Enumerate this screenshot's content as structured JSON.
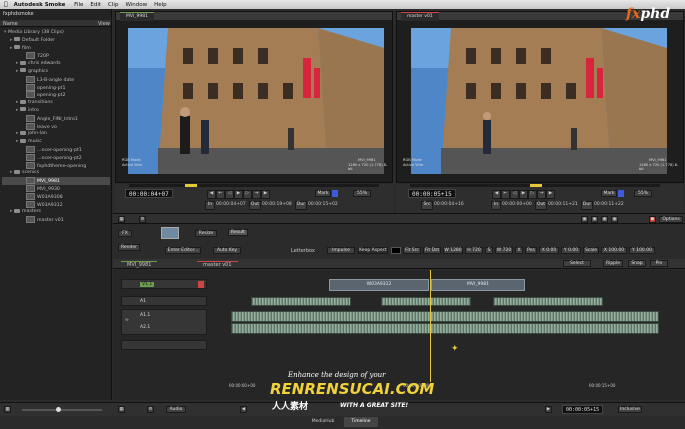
{
  "menubar": {
    "apple": "",
    "app_name": "Autodesk Smoke",
    "items": [
      "File",
      "Edit",
      "Clip",
      "Window",
      "Help"
    ]
  },
  "library": {
    "project": "fxphdsmoke",
    "name_col": "Name",
    "view_col": "View",
    "title": "Media Library (38 Clips)",
    "rows": [
      {
        "indent": 1,
        "kind": "folder",
        "label": "Default Folder"
      },
      {
        "indent": 1,
        "kind": "folder",
        "label": "film"
      },
      {
        "indent": 3,
        "kind": "clip",
        "label": "720P"
      },
      {
        "indent": 2,
        "kind": "folder",
        "label": "chris edwards"
      },
      {
        "indent": 2,
        "kind": "folder",
        "label": "graphics"
      },
      {
        "indent": 3,
        "kind": "clip",
        "label": "L3-B-angle date"
      },
      {
        "indent": 3,
        "kind": "clip",
        "label": "opening-pt1"
      },
      {
        "indent": 3,
        "kind": "clip",
        "label": "opening-pt2"
      },
      {
        "indent": 2,
        "kind": "folder",
        "label": "transitions"
      },
      {
        "indent": 2,
        "kind": "folder",
        "label": "intro"
      },
      {
        "indent": 3,
        "kind": "clip",
        "label": "Angle_FINI_Intro1"
      },
      {
        "indent": 3,
        "kind": "clip",
        "label": "leave vo"
      },
      {
        "indent": 2,
        "kind": "folder",
        "label": "john-lan"
      },
      {
        "indent": 2,
        "kind": "folder",
        "label": "music"
      },
      {
        "indent": 3,
        "kind": "clip",
        "label": "...ncer-opening-pt1"
      },
      {
        "indent": 3,
        "kind": "clip",
        "label": "...ncer-opening-pt2"
      },
      {
        "indent": 3,
        "kind": "clip",
        "label": "fxphdtheme-opening"
      },
      {
        "indent": 1,
        "kind": "folder",
        "label": "scenics"
      },
      {
        "indent": 3,
        "kind": "clip",
        "label": "MVI_9981",
        "selected": true
      },
      {
        "indent": 3,
        "kind": "clip",
        "label": "MVI_9930"
      },
      {
        "indent": 3,
        "kind": "clip",
        "label": "W03A9308"
      },
      {
        "indent": 3,
        "kind": "clip",
        "label": "W03A9312"
      },
      {
        "indent": 1,
        "kind": "folder",
        "label": "masters"
      },
      {
        "indent": 3,
        "kind": "clip",
        "label": "master v01"
      }
    ]
  },
  "source_viewer": {
    "tab": "MVI_9981",
    "ovl_tl": "RGB Mode",
    "ovl_bl": "Active    Wire",
    "ovl_tr": "MVI_9981",
    "ovl_br": "1280 x 720 (1.778) 8-bit",
    "timecode": "00:00:04+07",
    "in_label": "In",
    "in_tc": "00:00:04+07",
    "out_label": "Out",
    "out_tc": "00:00:19+08",
    "dur_label": "Dur",
    "dur_tc": "00:00:15+02",
    "mark": "Mark",
    "zoom": "55%"
  },
  "record_viewer": {
    "tab": "master v01",
    "ovl_tl": "RGB Mode",
    "ovl_bl": "Active    Wire",
    "ovl_tr": "MVI_9981",
    "ovl_br": "1280 x 720 (1.778) 8-bit",
    "timecode": "00:00:05+15",
    "src_label": "Src",
    "src_tc": "00:00:04+16",
    "in_label": "In",
    "in_tc": "00:00:00+00",
    "out_label": "Out",
    "out_tc": "00:00:11+21",
    "dur_label": "Dur",
    "dur_tc": "00:00:11+22",
    "mark": "Mark",
    "zoom": "55%",
    "options": "Options"
  },
  "fx_bar": {
    "fx": "FX",
    "clip_name": "Resize",
    "result": "Result",
    "render": "Render",
    "enter_editor": "Enter Editor...",
    "auto_key": "Auto Key",
    "letterbox": "Letterbox",
    "impulse": "Impulse",
    "keep_aspect": "Keep Aspect",
    "fit_src": "Fit Src",
    "fit_dst": "Fit Dst",
    "w": "W 1280",
    "h": "H 720",
    "s": "S",
    "w2": "W 720",
    "x": "X",
    "pos": "Pos",
    "x_val": "X 0.00",
    "y_val": "Y 0.00",
    "scale": "Scale",
    "x_scale": "X 100.00",
    "y_scale": "Y 100.00"
  },
  "timeline_tabs": {
    "left": "MVI_9981",
    "right": "master v01",
    "select": "Select",
    "ripple": "Ripple",
    "snap": "Snap",
    "pin": "Pin"
  },
  "tracks": {
    "video": {
      "label": "V1.1"
    },
    "audio1": {
      "label": "A1"
    },
    "audio2a": {
      "label": "A1.1"
    },
    "audio2b": {
      "label": "A2.1"
    },
    "clip_a": "W03A9312",
    "clip_b": "MVI_9981",
    "tc_left": "00:00:00+00",
    "tc_mid": "00:00:10+00",
    "tc_right": "00:00:15+00"
  },
  "bottom": {
    "audio": "Audio",
    "tc": "00:00:05+15",
    "inclusive": "Inclusive",
    "tab_mediahub": "MediaHub",
    "tab_timeline": "Timeline"
  },
  "watermark": {
    "fx": "fx",
    "phd": "phd",
    "line1": "Enhance the design of your",
    "line2": "RENRENSUCAI.COM",
    "line3": "人人素材",
    "line4": "WITH A GREAT SITE!"
  },
  "colors": {
    "accent_green": "#6b9e4d",
    "accent_red": "#cc4444",
    "logo_orange": "#e8681c",
    "mark_blue": "#3b5bd8",
    "playhead": "#e6c93a"
  }
}
